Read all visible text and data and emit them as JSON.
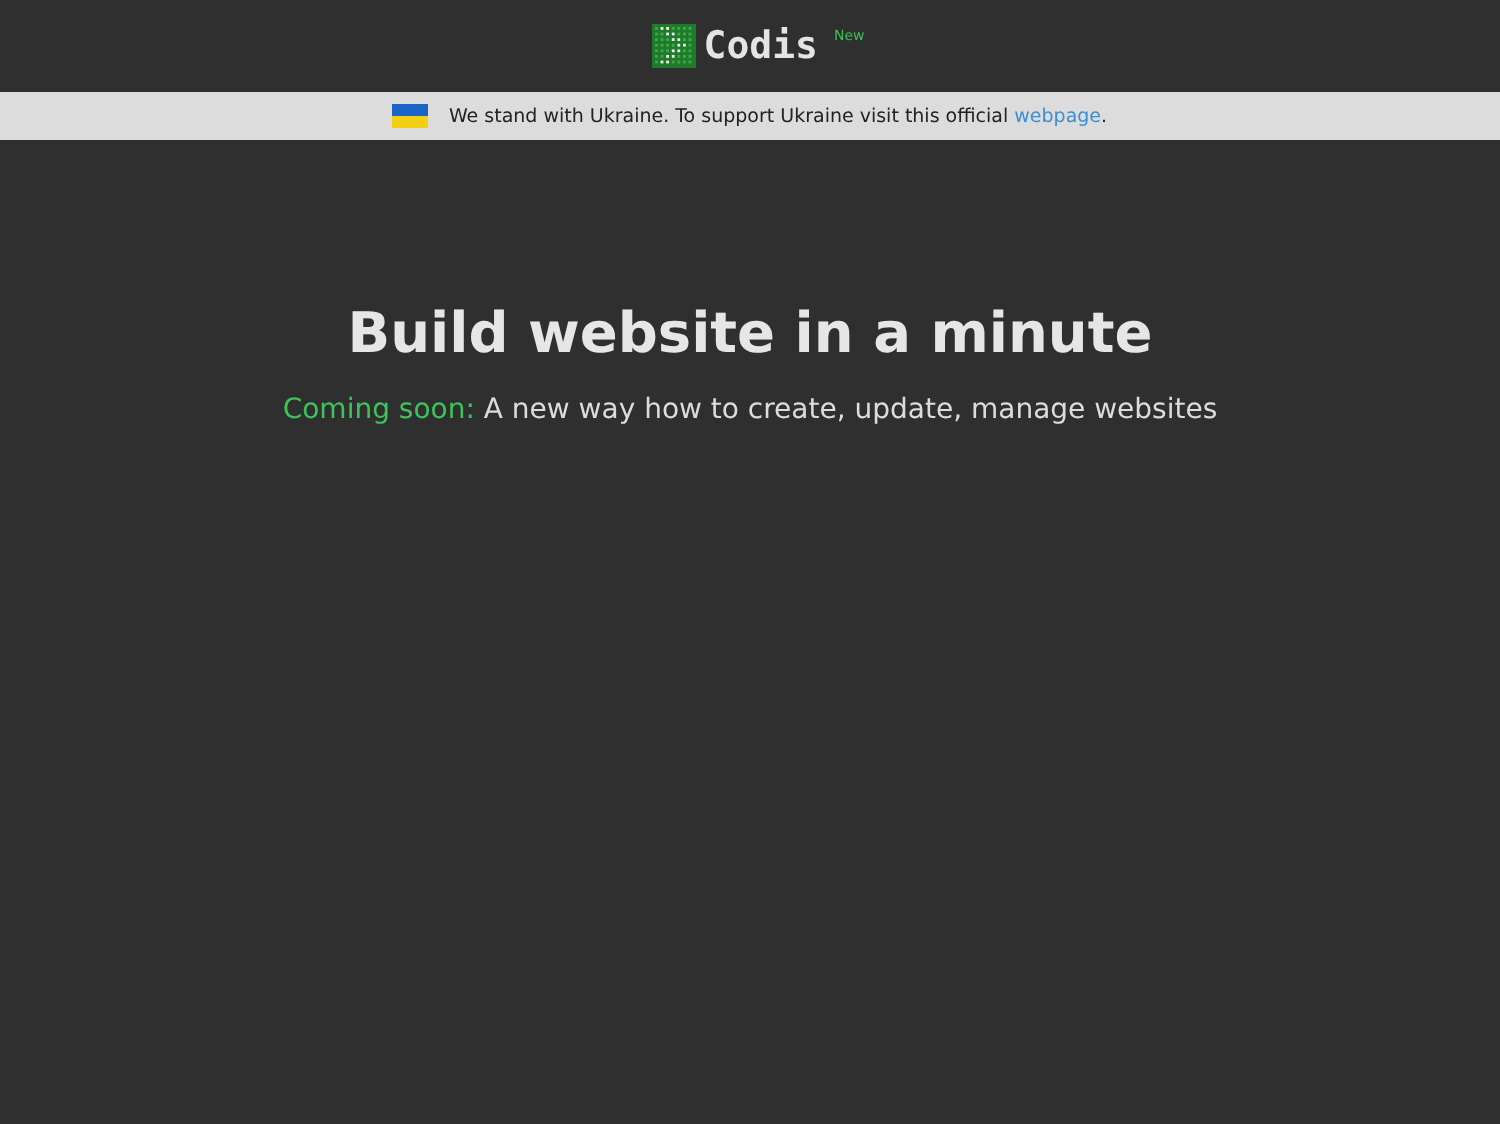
{
  "header": {
    "logo_text": "Codis",
    "badge": "New"
  },
  "banner": {
    "text": "We stand with Ukraine. To support Ukraine visit this official ",
    "link": "webpage",
    "text_after": "."
  },
  "hero": {
    "title": "Build website in a minute",
    "highlight": "Coming soon:",
    "subtitle": " A new way how to create, update, manage websites"
  }
}
